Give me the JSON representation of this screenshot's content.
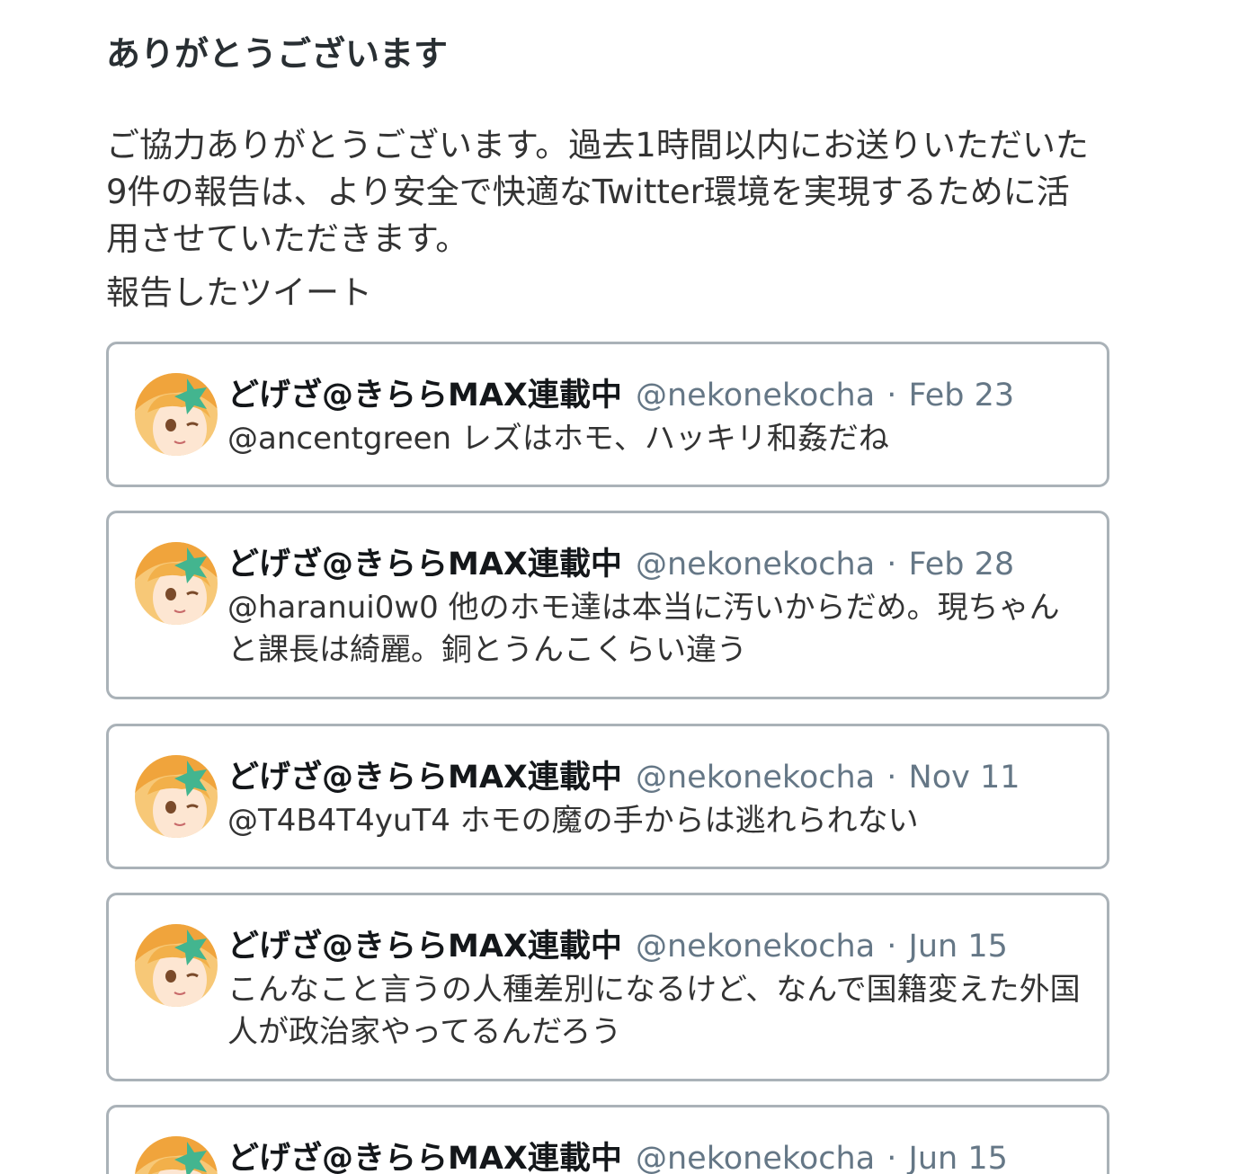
{
  "page": {
    "title": "ありがとうございます",
    "message": "ご協力ありがとうございます。過去1時間以内にお送りいただいた9件の報告は、より安全で快適なTwitter環境を実現するために活用させていただきます。",
    "reported_heading": "報告したツイート"
  },
  "tweets": [
    {
      "display_name": "どげざ@きららMAX連載中",
      "username": "@nekonekocha",
      "separator": "·",
      "date": "Feb 23",
      "text": "@ancentgreen レズはホモ、ハッキリ和姦だね"
    },
    {
      "display_name": "どげざ@きららMAX連載中",
      "username": "@nekonekocha",
      "separator": "·",
      "date": "Feb 28",
      "text": "@haranui0w0 他のホモ達は本当に汚いからだめ。現ちゃんと課長は綺麗。銅とうんこくらい違う"
    },
    {
      "display_name": "どげざ@きららMAX連載中",
      "username": "@nekonekocha",
      "separator": "·",
      "date": "Nov 11",
      "text": "@T4B4T4yuT4 ホモの魔の手からは逃れられない"
    },
    {
      "display_name": "どげざ@きららMAX連載中",
      "username": "@nekonekocha",
      "separator": "·",
      "date": "Jun 15",
      "text": "こんなこと言うの人種差別になるけど、なんで国籍変えた外国人が政治家やってるんだろう"
    },
    {
      "display_name": "どげざ@きららMAX連載中",
      "username": "@nekonekocha",
      "separator": "·",
      "date": "Jun 15",
      "text": ""
    }
  ],
  "icons": {
    "avatar": "anime-avatar-icon"
  },
  "colors": {
    "heading": "#292f33",
    "body_text": "#333333",
    "display_name": "#14171a",
    "secondary_text": "#657786",
    "card_border": "#aab2b8"
  }
}
